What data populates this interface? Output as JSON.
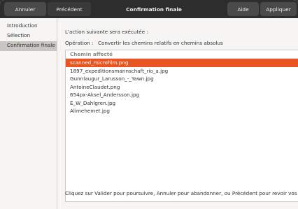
{
  "header": {
    "cancel_label": "Annuler",
    "previous_label": "Précédent",
    "title": "Confirmation finale",
    "help_label": "Aide",
    "apply_label": "Appliquer"
  },
  "sidebar": {
    "items": [
      {
        "label": "Introduction"
      },
      {
        "label": "Sélection"
      },
      {
        "label": "Confirmation finale"
      }
    ]
  },
  "main": {
    "intro": "L'action suivante sera exécutée :",
    "operation_label": "Opération :",
    "operation_value": "Convertir les chemins relatifs en chemins absolus",
    "list_header": "Chemin affecté",
    "rows": [
      "scanned_microfilm.png",
      "1897_expeditionsmannschaft_rio_a.jpg",
      "Gunnlaugur_Larusson_-_Yawn.jpg",
      "AntoineClaudet.png",
      "654px-Aksel_Andersson.jpg",
      "E_W_Dahlgren.jpg",
      "Alimehemet.jpg"
    ],
    "selected_row": "scanned_microfilm.png",
    "footer": "Cliquez sur Valider pour poursuivre, Annuler pour abandonner, ou Précédent pour revoir vos choix."
  },
  "colors": {
    "accent": "#e95420",
    "headerbar": "#2d2d2d"
  }
}
